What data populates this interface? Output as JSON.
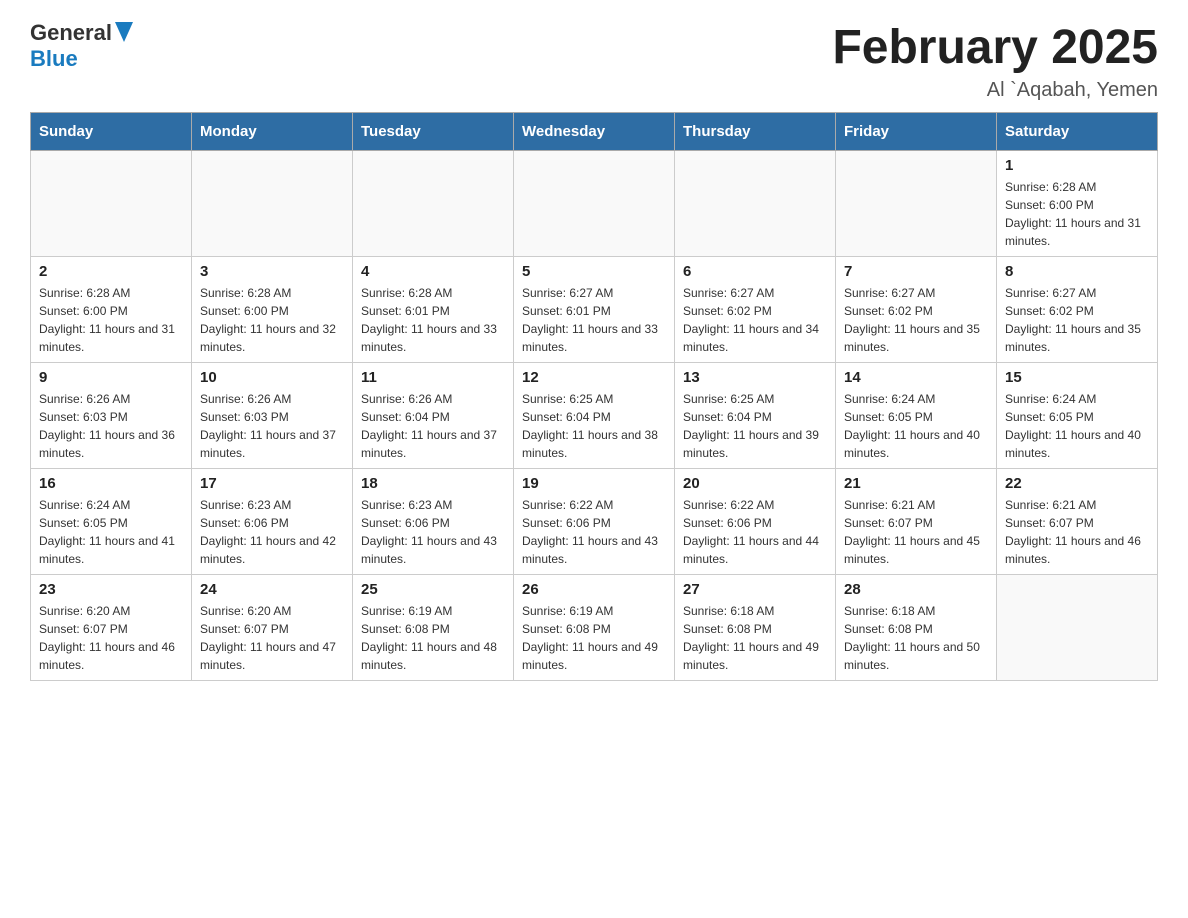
{
  "header": {
    "logo_general": "General",
    "logo_blue": "Blue",
    "title": "February 2025",
    "subtitle": "Al `Aqabah, Yemen"
  },
  "days_of_week": [
    "Sunday",
    "Monday",
    "Tuesday",
    "Wednesday",
    "Thursday",
    "Friday",
    "Saturday"
  ],
  "weeks": [
    [
      {
        "day": "",
        "sunrise": "",
        "sunset": "",
        "daylight": "",
        "empty": true
      },
      {
        "day": "",
        "sunrise": "",
        "sunset": "",
        "daylight": "",
        "empty": true
      },
      {
        "day": "",
        "sunrise": "",
        "sunset": "",
        "daylight": "",
        "empty": true
      },
      {
        "day": "",
        "sunrise": "",
        "sunset": "",
        "daylight": "",
        "empty": true
      },
      {
        "day": "",
        "sunrise": "",
        "sunset": "",
        "daylight": "",
        "empty": true
      },
      {
        "day": "",
        "sunrise": "",
        "sunset": "",
        "daylight": "",
        "empty": true
      },
      {
        "day": "1",
        "sunrise": "Sunrise: 6:28 AM",
        "sunset": "Sunset: 6:00 PM",
        "daylight": "Daylight: 11 hours and 31 minutes.",
        "empty": false
      }
    ],
    [
      {
        "day": "2",
        "sunrise": "Sunrise: 6:28 AM",
        "sunset": "Sunset: 6:00 PM",
        "daylight": "Daylight: 11 hours and 31 minutes.",
        "empty": false
      },
      {
        "day": "3",
        "sunrise": "Sunrise: 6:28 AM",
        "sunset": "Sunset: 6:00 PM",
        "daylight": "Daylight: 11 hours and 32 minutes.",
        "empty": false
      },
      {
        "day": "4",
        "sunrise": "Sunrise: 6:28 AM",
        "sunset": "Sunset: 6:01 PM",
        "daylight": "Daylight: 11 hours and 33 minutes.",
        "empty": false
      },
      {
        "day": "5",
        "sunrise": "Sunrise: 6:27 AM",
        "sunset": "Sunset: 6:01 PM",
        "daylight": "Daylight: 11 hours and 33 minutes.",
        "empty": false
      },
      {
        "day": "6",
        "sunrise": "Sunrise: 6:27 AM",
        "sunset": "Sunset: 6:02 PM",
        "daylight": "Daylight: 11 hours and 34 minutes.",
        "empty": false
      },
      {
        "day": "7",
        "sunrise": "Sunrise: 6:27 AM",
        "sunset": "Sunset: 6:02 PM",
        "daylight": "Daylight: 11 hours and 35 minutes.",
        "empty": false
      },
      {
        "day": "8",
        "sunrise": "Sunrise: 6:27 AM",
        "sunset": "Sunset: 6:02 PM",
        "daylight": "Daylight: 11 hours and 35 minutes.",
        "empty": false
      }
    ],
    [
      {
        "day": "9",
        "sunrise": "Sunrise: 6:26 AM",
        "sunset": "Sunset: 6:03 PM",
        "daylight": "Daylight: 11 hours and 36 minutes.",
        "empty": false
      },
      {
        "day": "10",
        "sunrise": "Sunrise: 6:26 AM",
        "sunset": "Sunset: 6:03 PM",
        "daylight": "Daylight: 11 hours and 37 minutes.",
        "empty": false
      },
      {
        "day": "11",
        "sunrise": "Sunrise: 6:26 AM",
        "sunset": "Sunset: 6:04 PM",
        "daylight": "Daylight: 11 hours and 37 minutes.",
        "empty": false
      },
      {
        "day": "12",
        "sunrise": "Sunrise: 6:25 AM",
        "sunset": "Sunset: 6:04 PM",
        "daylight": "Daylight: 11 hours and 38 minutes.",
        "empty": false
      },
      {
        "day": "13",
        "sunrise": "Sunrise: 6:25 AM",
        "sunset": "Sunset: 6:04 PM",
        "daylight": "Daylight: 11 hours and 39 minutes.",
        "empty": false
      },
      {
        "day": "14",
        "sunrise": "Sunrise: 6:24 AM",
        "sunset": "Sunset: 6:05 PM",
        "daylight": "Daylight: 11 hours and 40 minutes.",
        "empty": false
      },
      {
        "day": "15",
        "sunrise": "Sunrise: 6:24 AM",
        "sunset": "Sunset: 6:05 PM",
        "daylight": "Daylight: 11 hours and 40 minutes.",
        "empty": false
      }
    ],
    [
      {
        "day": "16",
        "sunrise": "Sunrise: 6:24 AM",
        "sunset": "Sunset: 6:05 PM",
        "daylight": "Daylight: 11 hours and 41 minutes.",
        "empty": false
      },
      {
        "day": "17",
        "sunrise": "Sunrise: 6:23 AM",
        "sunset": "Sunset: 6:06 PM",
        "daylight": "Daylight: 11 hours and 42 minutes.",
        "empty": false
      },
      {
        "day": "18",
        "sunrise": "Sunrise: 6:23 AM",
        "sunset": "Sunset: 6:06 PM",
        "daylight": "Daylight: 11 hours and 43 minutes.",
        "empty": false
      },
      {
        "day": "19",
        "sunrise": "Sunrise: 6:22 AM",
        "sunset": "Sunset: 6:06 PM",
        "daylight": "Daylight: 11 hours and 43 minutes.",
        "empty": false
      },
      {
        "day": "20",
        "sunrise": "Sunrise: 6:22 AM",
        "sunset": "Sunset: 6:06 PM",
        "daylight": "Daylight: 11 hours and 44 minutes.",
        "empty": false
      },
      {
        "day": "21",
        "sunrise": "Sunrise: 6:21 AM",
        "sunset": "Sunset: 6:07 PM",
        "daylight": "Daylight: 11 hours and 45 minutes.",
        "empty": false
      },
      {
        "day": "22",
        "sunrise": "Sunrise: 6:21 AM",
        "sunset": "Sunset: 6:07 PM",
        "daylight": "Daylight: 11 hours and 46 minutes.",
        "empty": false
      }
    ],
    [
      {
        "day": "23",
        "sunrise": "Sunrise: 6:20 AM",
        "sunset": "Sunset: 6:07 PM",
        "daylight": "Daylight: 11 hours and 46 minutes.",
        "empty": false
      },
      {
        "day": "24",
        "sunrise": "Sunrise: 6:20 AM",
        "sunset": "Sunset: 6:07 PM",
        "daylight": "Daylight: 11 hours and 47 minutes.",
        "empty": false
      },
      {
        "day": "25",
        "sunrise": "Sunrise: 6:19 AM",
        "sunset": "Sunset: 6:08 PM",
        "daylight": "Daylight: 11 hours and 48 minutes.",
        "empty": false
      },
      {
        "day": "26",
        "sunrise": "Sunrise: 6:19 AM",
        "sunset": "Sunset: 6:08 PM",
        "daylight": "Daylight: 11 hours and 49 minutes.",
        "empty": false
      },
      {
        "day": "27",
        "sunrise": "Sunrise: 6:18 AM",
        "sunset": "Sunset: 6:08 PM",
        "daylight": "Daylight: 11 hours and 49 minutes.",
        "empty": false
      },
      {
        "day": "28",
        "sunrise": "Sunrise: 6:18 AM",
        "sunset": "Sunset: 6:08 PM",
        "daylight": "Daylight: 11 hours and 50 minutes.",
        "empty": false
      },
      {
        "day": "",
        "sunrise": "",
        "sunset": "",
        "daylight": "",
        "empty": true
      }
    ]
  ]
}
